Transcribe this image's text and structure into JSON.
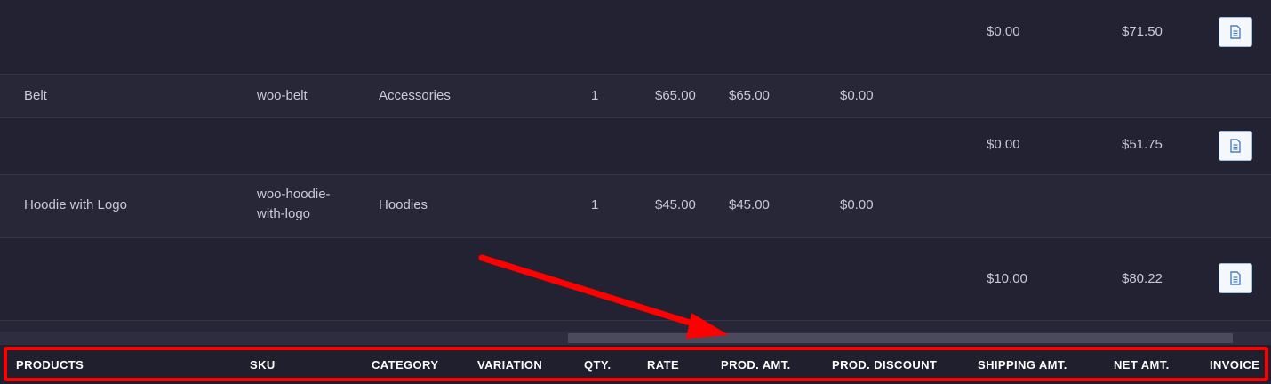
{
  "rows": [
    {
      "shipping": "$0.00",
      "net": "$71.50"
    },
    {
      "product": "Belt",
      "sku": "woo-belt",
      "category": "Accessories",
      "qty": "1",
      "rate": "$65.00",
      "prod_amt": "$65.00",
      "discount": "$0.00"
    },
    {
      "shipping": "$0.00",
      "net": "$51.75"
    },
    {
      "product": "Hoodie with Logo",
      "sku": "woo-hoodie-with-logo",
      "category": "Hoodies",
      "qty": "1",
      "rate": "$45.00",
      "prod_amt": "$45.00",
      "discount": "$0.00"
    },
    {
      "shipping": "$10.00",
      "net": "$80.22"
    }
  ],
  "headers": {
    "products": "PRODUCTS",
    "sku": "SKU",
    "category": "CATEGORY",
    "variation": "VARIATION",
    "qty": "QTY.",
    "rate": "RATE",
    "prod_amt": "PROD. AMT.",
    "prod_discount": "PROD. DISCOUNT",
    "shipping_amt": "SHIPPING AMT.",
    "net_amt": "NET AMT.",
    "invoice": "INVOICE"
  },
  "icons": {
    "invoice": "document-icon"
  },
  "colors": {
    "annotation": "#ff0000",
    "icon": "#4a7fbf"
  }
}
